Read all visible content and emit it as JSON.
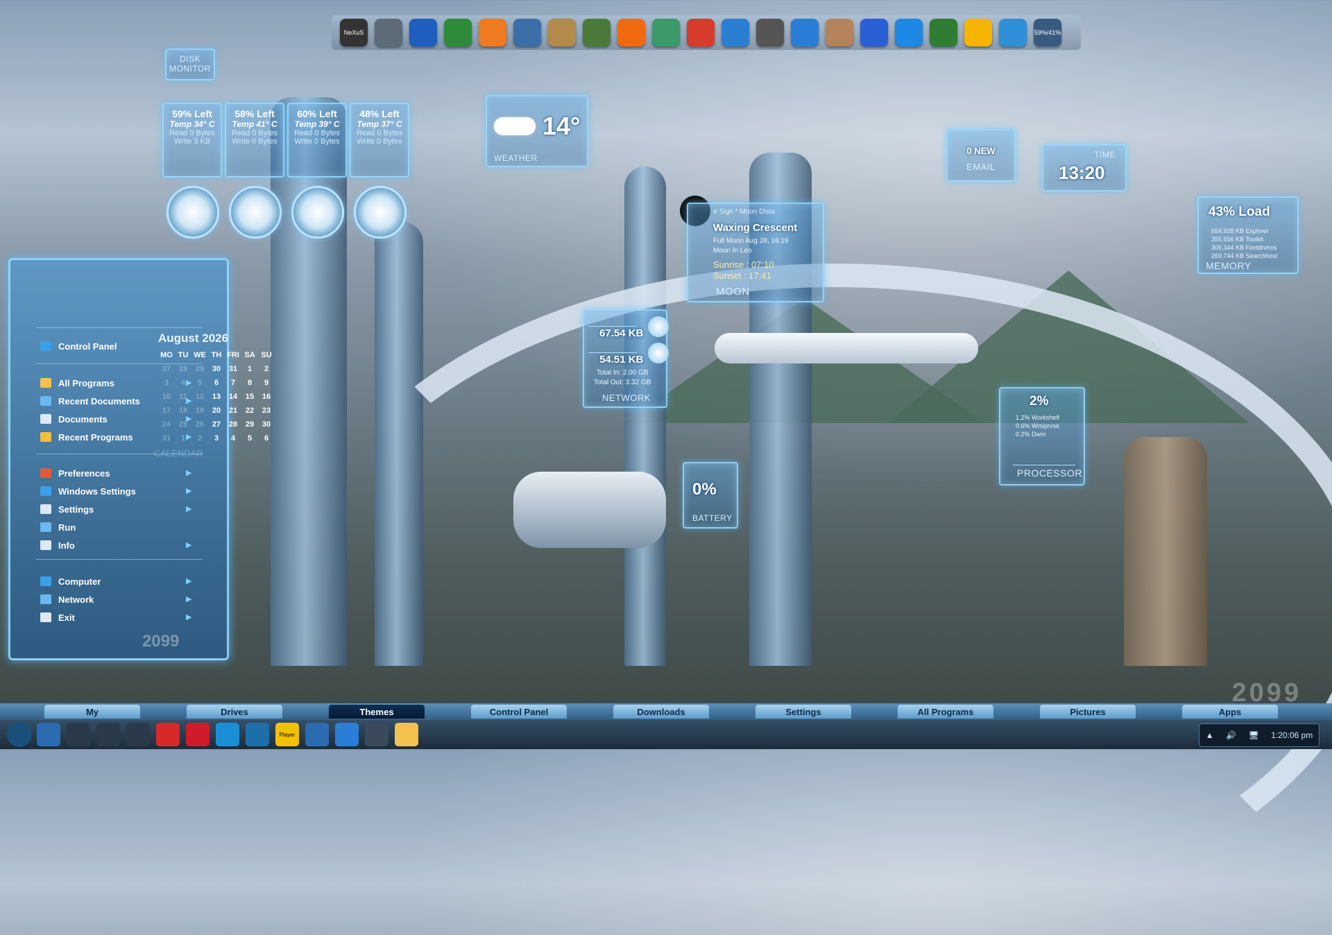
{
  "colors": {
    "accent": "#7fd0ff",
    "panel_glow": "#50beff",
    "taskbar": "#1c2b3a",
    "active_tab": "#061a31"
  },
  "dock": {
    "items": [
      {
        "name": "nexus-icon",
        "label": "NeXuS"
      },
      {
        "name": "wings-icon"
      },
      {
        "name": "back-arrow-icon"
      },
      {
        "name": "media-icon"
      },
      {
        "name": "p-icon"
      },
      {
        "name": "monitor-icon"
      },
      {
        "name": "paint-tools-icon"
      },
      {
        "name": "phone-icon"
      },
      {
        "name": "vlc-cone-icon"
      },
      {
        "name": "globe-icon"
      },
      {
        "name": "pdf-icon"
      },
      {
        "name": "library-icon"
      },
      {
        "name": "camera-icon"
      },
      {
        "name": "windows-flag-icon"
      },
      {
        "name": "palette-icon"
      },
      {
        "name": "music-note-icon"
      },
      {
        "name": "speaker-icon"
      },
      {
        "name": "power-icon"
      },
      {
        "name": "alarm-clock-icon"
      },
      {
        "name": "color-picker-icon"
      },
      {
        "name": "drive-icon",
        "label": "59%/41%"
      }
    ]
  },
  "disk_monitor": {
    "title_line1": "DISK",
    "title_line2": "MONITOR",
    "disks": [
      {
        "left": "59% Left",
        "temp": "Temp 34° C",
        "read": "Read 0 Bytes",
        "write": "Write 3 KB"
      },
      {
        "left": "58% Left",
        "temp": "Temp 41° C",
        "read": "Read 0 Bytes",
        "write": "Write 0 Bytes"
      },
      {
        "left": "60% Left",
        "temp": "Temp 39° C",
        "read": "Read 0 Bytes",
        "write": "Write 0 Bytes"
      },
      {
        "left": "48% Left",
        "temp": "Temp 37° C",
        "read": "Read 0 Bytes",
        "write": "Write 0 Bytes"
      }
    ]
  },
  "weather": {
    "temp": "14°",
    "label": "WEATHER"
  },
  "moon": {
    "ticker": "ır Sign * Moon Dista",
    "phase": "Waxing Crescent",
    "full_moon": "Full Moon Aug 28, 16:19",
    "moon_in": "Moon In Leo",
    "sunrise": "Sunrise : 07:10",
    "sunset": "Sunset : 17:41",
    "label": "MOON"
  },
  "email": {
    "count": "0 NEW",
    "label": "EMAIL"
  },
  "time": {
    "label": "TIME",
    "value": "13:20"
  },
  "memory": {
    "load": "43% Load",
    "processes": [
      "654,928 KB Explorer",
      "355,656 KB Toolkit",
      "306,344 KB Fontdrvhos",
      "269,744 KB Searchhost"
    ],
    "label": "MEMORY"
  },
  "network": {
    "down": "67.54 KB",
    "up": "54.51 KB",
    "total_in": "Total In: 2.00 GB",
    "total_out": "Total Out: 3.32 GB",
    "label": "NETWORK"
  },
  "processor": {
    "load": "2%",
    "processes": [
      "1.2% Workshelf",
      "0.6% Wmiprvse",
      "0.2% Dwm"
    ],
    "label": "PROCESSOR"
  },
  "battery": {
    "value": "0%",
    "label": "BATTERY"
  },
  "start_menu": {
    "items": [
      {
        "label": "Control Panel",
        "icon": "control-panel-icon",
        "color": "#3aa0e8"
      },
      {
        "label": "All Programs",
        "icon": "folder-icon",
        "color": "#f4c24a"
      },
      {
        "label": "Recent Documents",
        "icon": "recent-docs-icon",
        "color": "#6ab8f0"
      },
      {
        "label": "Documents",
        "icon": "documents-icon",
        "color": "#dfe9f3"
      },
      {
        "label": "Recent Programs",
        "icon": "recent-programs-icon",
        "color": "#f0c040"
      },
      {
        "label": "Preferences",
        "icon": "preferences-icon",
        "color": "#e05a3a"
      },
      {
        "label": "Windows Settings",
        "icon": "windows-icon",
        "color": "#3aa0e8"
      },
      {
        "label": "Settings",
        "icon": "settings-icon",
        "color": "#dfe9f3"
      },
      {
        "label": "Run",
        "icon": "run-icon",
        "color": "#6ab8f0"
      },
      {
        "label": "Info",
        "icon": "info-icon",
        "color": "#dfe9f3"
      },
      {
        "label": "Computer",
        "icon": "computer-icon",
        "color": "#3aa0e8"
      },
      {
        "label": "Network",
        "icon": "network-icon",
        "color": "#6ab8f0"
      },
      {
        "label": "Exit",
        "icon": "exit-icon",
        "color": "#dfe9f3"
      }
    ],
    "badge": "2099"
  },
  "calendar": {
    "month_year": "August 2026",
    "days": [
      "MO",
      "TU",
      "WE",
      "TH",
      "FRI",
      "SA",
      "SU"
    ],
    "weeks": [
      [
        "27",
        "28",
        "29",
        "30",
        "31",
        "1",
        "2"
      ],
      [
        "3",
        "4",
        "5",
        "6",
        "7",
        "8",
        "9"
      ],
      [
        "10",
        "11",
        "12",
        "13",
        "14",
        "15",
        "16"
      ],
      [
        "17",
        "18",
        "19",
        "20",
        "21",
        "22",
        "23"
      ],
      [
        "24",
        "25",
        "26",
        "27",
        "28",
        "29",
        "30"
      ],
      [
        "31",
        "1",
        "2",
        "3",
        "4",
        "5",
        "6"
      ]
    ],
    "label": "CALENDAR"
  },
  "corner_brand": "2099",
  "tabs": [
    {
      "label": "My"
    },
    {
      "label": "Drives"
    },
    {
      "label": "Themes",
      "active": true
    },
    {
      "label": "Control Panel"
    },
    {
      "label": "Downloads"
    },
    {
      "label": "Settings"
    },
    {
      "label": "All Programs"
    },
    {
      "label": "Pictures"
    },
    {
      "label": "Apps"
    }
  ],
  "taskbar": {
    "items": [
      {
        "name": "start-orb-icon"
      },
      {
        "name": "windows-start-icon"
      },
      {
        "name": "search-icon"
      },
      {
        "name": "task-view-icon"
      },
      {
        "name": "chat-icon"
      },
      {
        "name": "vivaldi-icon"
      },
      {
        "name": "opera-icon"
      },
      {
        "name": "edge-icon"
      },
      {
        "name": "timer-icon"
      },
      {
        "name": "player-icon",
        "label": "Player"
      },
      {
        "name": "windows-store-icon"
      },
      {
        "name": "desktop-icon"
      },
      {
        "name": "remote-desktop-icon"
      },
      {
        "name": "file-explorer-icon"
      }
    ],
    "clock": "1:20:06 pm"
  }
}
